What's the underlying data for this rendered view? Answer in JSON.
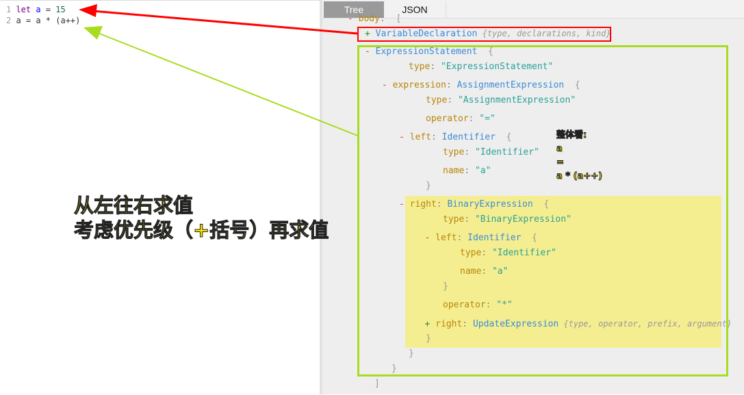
{
  "editor": {
    "lines": [
      [
        [
          "ln",
          "1 "
        ],
        [
          "kw",
          "let "
        ],
        [
          "var",
          "a"
        ],
        [
          "op",
          " = "
        ],
        [
          "num",
          "15"
        ]
      ],
      [
        [
          "ln",
          "2 "
        ],
        [
          "op",
          "a = a * (a++)"
        ]
      ]
    ]
  },
  "tabs": {
    "tree": "Tree",
    "json": "JSON",
    "active": "Tree"
  },
  "tree": [
    {
      "indent": 0,
      "seg": [
        [
          "minus",
          "- "
        ],
        [
          "key",
          "body"
        ],
        [
          "punct",
          ":  "
        ],
        [
          "brace",
          "["
        ]
      ]
    },
    {
      "indent": 1,
      "seg": [
        [
          "plus",
          "+ "
        ],
        [
          "node",
          "VariableDeclaration"
        ],
        [
          "hint",
          " {type, declarations, kind}"
        ]
      ]
    },
    {
      "indent": 1,
      "seg": [
        [
          "minus",
          "- "
        ],
        [
          "node",
          "ExpressionStatement"
        ],
        [
          "brace",
          "  {"
        ]
      ]
    },
    {
      "indent": 3,
      "seg": [
        [
          "key",
          "type"
        ],
        [
          "punct",
          ": "
        ],
        [
          "str",
          "\"ExpressionStatement\""
        ]
      ]
    },
    {
      "indent": 2,
      "seg": [
        [
          "minus",
          "- "
        ],
        [
          "key",
          "expression"
        ],
        [
          "punct",
          ": "
        ],
        [
          "node",
          "AssignmentExpression"
        ],
        [
          "brace",
          "  {"
        ]
      ]
    },
    {
      "indent": 4,
      "seg": [
        [
          "key",
          "type"
        ],
        [
          "punct",
          ": "
        ],
        [
          "str",
          "\"AssignmentExpression\""
        ]
      ]
    },
    {
      "indent": 4,
      "seg": [
        [
          "key",
          "operator"
        ],
        [
          "punct",
          ": "
        ],
        [
          "str",
          "\"=\""
        ]
      ]
    },
    {
      "indent": 3,
      "seg": [
        [
          "minus",
          "- "
        ],
        [
          "key",
          "left"
        ],
        [
          "punct",
          ": "
        ],
        [
          "node",
          "Identifier"
        ],
        [
          "brace",
          "  {"
        ]
      ]
    },
    {
      "indent": 5,
      "seg": [
        [
          "key",
          "type"
        ],
        [
          "punct",
          ": "
        ],
        [
          "str",
          "\"Identifier\""
        ]
      ]
    },
    {
      "indent": 5,
      "seg": [
        [
          "key",
          "name"
        ],
        [
          "punct",
          ": "
        ],
        [
          "str",
          "\"a\""
        ]
      ]
    },
    {
      "indent": 4,
      "seg": [
        [
          "brace",
          "}"
        ]
      ]
    },
    {
      "indent": 3,
      "seg": [
        [
          "minus",
          "- "
        ],
        [
          "key",
          "right"
        ],
        [
          "punct",
          ": "
        ],
        [
          "node",
          "BinaryExpression"
        ],
        [
          "brace",
          "  {"
        ]
      ]
    },
    {
      "indent": 5,
      "seg": [
        [
          "key",
          "type"
        ],
        [
          "punct",
          ": "
        ],
        [
          "str",
          "\"BinaryExpression\""
        ]
      ]
    },
    {
      "indent": 4.5,
      "seg": [
        [
          "minus",
          "- "
        ],
        [
          "key",
          "left"
        ],
        [
          "punct",
          ": "
        ],
        [
          "node",
          "Identifier"
        ],
        [
          "brace",
          "  {"
        ]
      ]
    },
    {
      "indent": 6,
      "seg": [
        [
          "key",
          "type"
        ],
        [
          "punct",
          ": "
        ],
        [
          "str",
          "\"Identifier\""
        ]
      ]
    },
    {
      "indent": 6,
      "seg": [
        [
          "key",
          "name"
        ],
        [
          "punct",
          ": "
        ],
        [
          "str",
          "\"a\""
        ]
      ]
    },
    {
      "indent": 5,
      "seg": [
        [
          "brace",
          "}"
        ]
      ]
    },
    {
      "indent": 5,
      "seg": [
        [
          "key",
          "operator"
        ],
        [
          "punct",
          ": "
        ],
        [
          "str",
          "\"*\""
        ]
      ]
    },
    {
      "indent": 4.5,
      "seg": [
        [
          "plus",
          "+ "
        ],
        [
          "key",
          "right"
        ],
        [
          "punct",
          ": "
        ],
        [
          "node",
          "UpdateExpression"
        ],
        [
          "hint",
          " {type, operator, prefix, argument}"
        ]
      ]
    },
    {
      "indent": 4,
      "seg": [
        [
          "brace",
          "}"
        ]
      ]
    },
    {
      "indent": 3,
      "seg": [
        [
          "brace",
          "}"
        ]
      ]
    },
    {
      "indent": 2,
      "seg": [
        [
          "brace",
          "}"
        ]
      ]
    },
    {
      "indent": 1,
      "seg": [
        [
          "brace",
          "]"
        ]
      ]
    }
  ],
  "annotations": {
    "big": [
      "从左往右求值",
      "考虑优先级（+括号）再求值"
    ],
    "small": [
      "整体看:",
      "a",
      "=",
      "a * (a++)"
    ]
  },
  "colors": {
    "red_arrow": "#ff0000",
    "green_arrow": "#a8dc1e",
    "highlight": "#f5ee90"
  }
}
